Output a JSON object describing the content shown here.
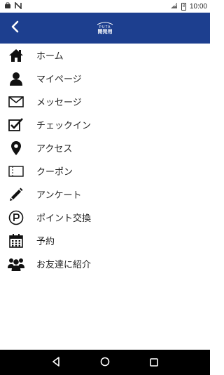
{
  "status_bar": {
    "time": "10:00",
    "battery_level": "8"
  },
  "app_bar": {
    "logo_top": "PUTA",
    "logo_bottom": "開発用"
  },
  "menu": {
    "items": [
      {
        "label": "ホーム",
        "icon": "home-icon"
      },
      {
        "label": "マイページ",
        "icon": "user-icon"
      },
      {
        "label": "メッセージ",
        "icon": "envelope-icon"
      },
      {
        "label": "チェックイン",
        "icon": "checkbox-icon"
      },
      {
        "label": "アクセス",
        "icon": "map-pin-icon"
      },
      {
        "label": "クーポン",
        "icon": "coupon-icon"
      },
      {
        "label": "アンケート",
        "icon": "pencil-icon"
      },
      {
        "label": "ポイント交換",
        "icon": "points-icon"
      },
      {
        "label": "予約",
        "icon": "calendar-icon"
      },
      {
        "label": "お友達に紹介",
        "icon": "group-icon"
      }
    ]
  },
  "colors": {
    "app_bar": "#1d3f8f",
    "icon": "#111111",
    "text": "#222222",
    "nav_bar": "#000000"
  }
}
